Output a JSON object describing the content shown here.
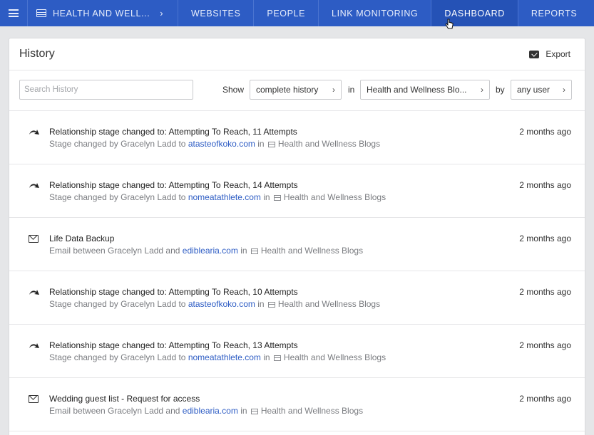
{
  "nav": {
    "menu_icon": "hamburger-icon",
    "project": "HEALTH AND WELL...",
    "tabs": [
      {
        "label": "WEBSITES",
        "active": false
      },
      {
        "label": "PEOPLE",
        "active": false
      },
      {
        "label": "LINK MONITORING",
        "active": false
      },
      {
        "label": "DASHBOARD",
        "active": true
      },
      {
        "label": "REPORTS",
        "active": false
      }
    ]
  },
  "history": {
    "title": "History",
    "export_label": "Export",
    "search_placeholder": "Search History",
    "show_label": "Show",
    "show_value": "complete history",
    "in_label": "in",
    "in_value": "Health and Wellness Blo...",
    "by_label": "by",
    "by_value": "any user"
  },
  "items": [
    {
      "icon": "relationship-arrow-icon",
      "title": "Relationship stage changed to: Attempting To Reach, 11 Attempts",
      "prefix": "Stage changed by Gracelyn Ladd to",
      "link": "atasteofkoko.com",
      "in": "in",
      "project": "Health and Wellness Blogs",
      "time": "2 months ago"
    },
    {
      "icon": "relationship-arrow-icon",
      "title": "Relationship stage changed to: Attempting To Reach, 14 Attempts",
      "prefix": "Stage changed by Gracelyn Ladd to",
      "link": "nomeatathlete.com",
      "in": "in",
      "project": "Health and Wellness Blogs",
      "time": "2 months ago"
    },
    {
      "icon": "envelope-icon",
      "title": "Life Data Backup",
      "prefix": "Email between Gracelyn Ladd and",
      "link": "ediblearia.com",
      "in": "in",
      "project": "Health and Wellness Blogs",
      "time": "2 months ago"
    },
    {
      "icon": "relationship-arrow-icon",
      "title": "Relationship stage changed to: Attempting To Reach, 10 Attempts",
      "prefix": "Stage changed by Gracelyn Ladd to",
      "link": "atasteofkoko.com",
      "in": "in",
      "project": "Health and Wellness Blogs",
      "time": "2 months ago"
    },
    {
      "icon": "relationship-arrow-icon",
      "title": "Relationship stage changed to: Attempting To Reach, 13 Attempts",
      "prefix": "Stage changed by Gracelyn Ladd to",
      "link": "nomeatathlete.com",
      "in": "in",
      "project": "Health and Wellness Blogs",
      "time": "2 months ago"
    },
    {
      "icon": "envelope-icon",
      "title": "Wedding guest list - Request for access",
      "prefix": "Email between Gracelyn Ladd and",
      "link": "ediblearia.com",
      "in": "in",
      "project": "Health and Wellness Blogs",
      "time": "2 months ago"
    }
  ],
  "colors": {
    "nav_bg": "#2d5cc4",
    "link": "#2d5cc4"
  }
}
